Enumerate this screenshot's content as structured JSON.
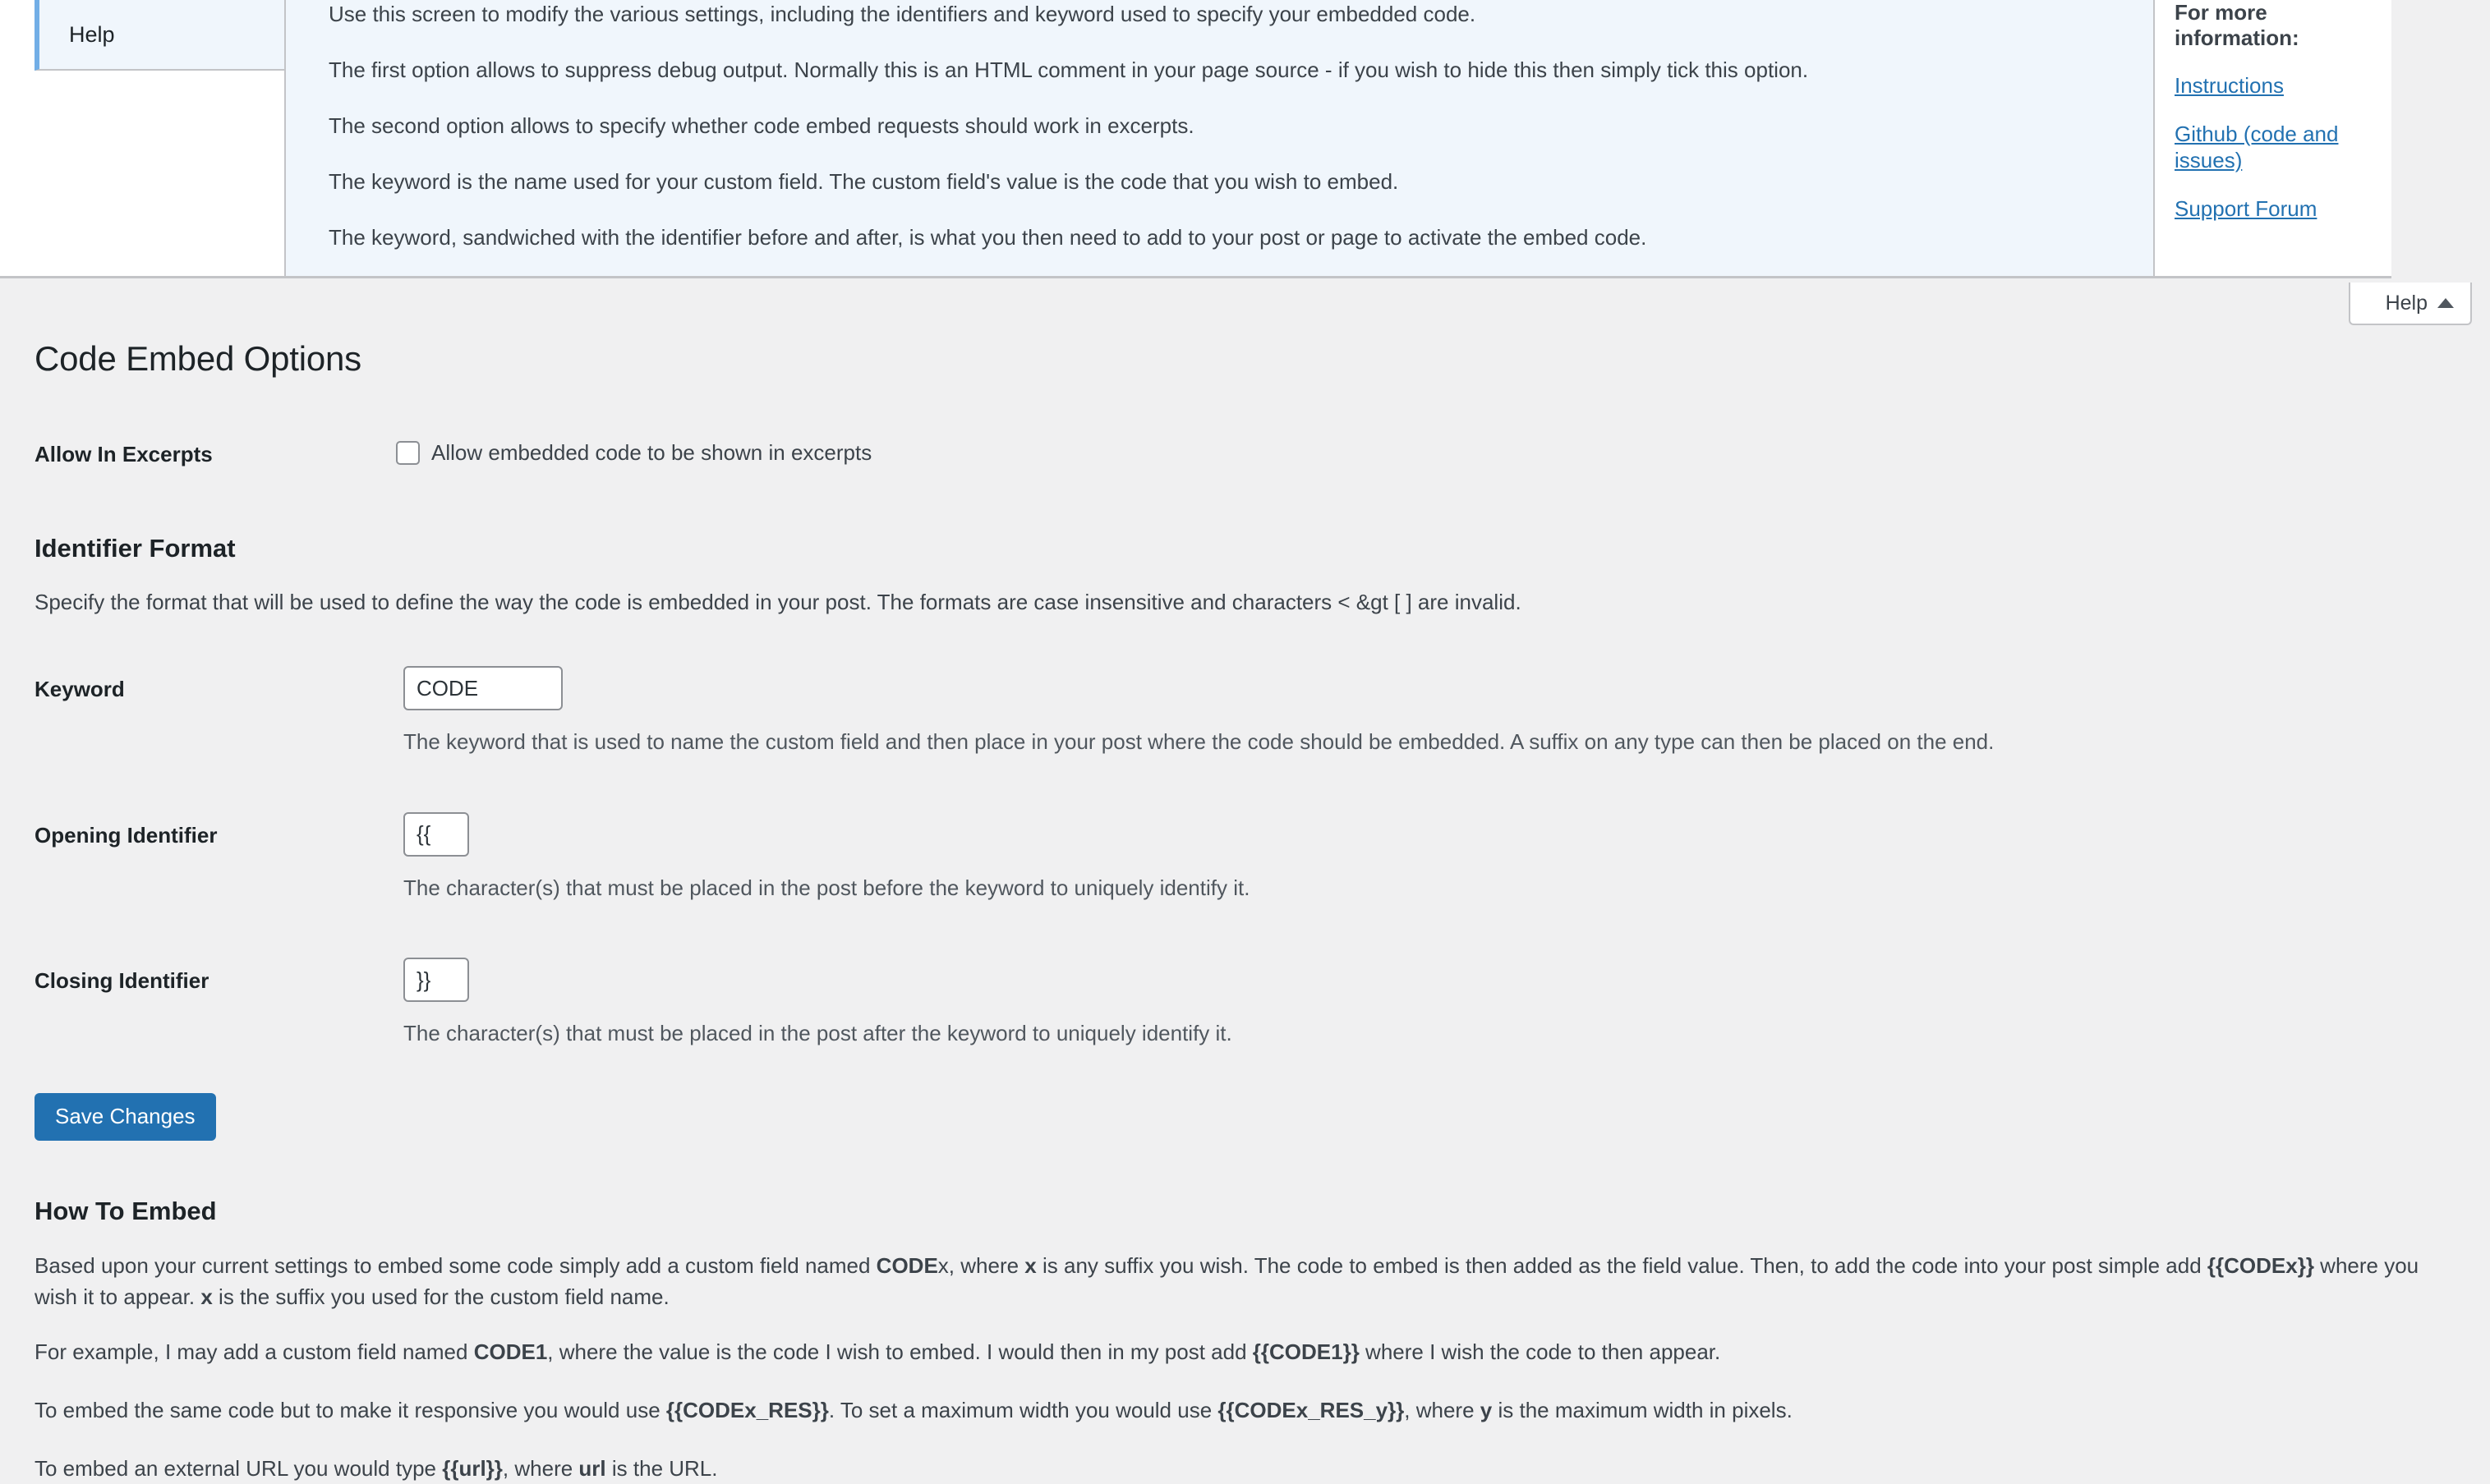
{
  "help_panel": {
    "tabs": [
      {
        "label": "Help",
        "active": true
      }
    ],
    "paragraphs": [
      "Use this screen to modify the various settings, including the identifiers and keyword used to specify your embedded code.",
      "The first option allows to suppress debug output. Normally this is an HTML comment in your page source - if you wish to hide this then simply tick this option.",
      "The second option allows to specify whether code embed requests should work in excerpts.",
      "The keyword is the name used for your custom field. The custom field's value is the code that you wish to embed.",
      "The keyword, sandwiched with the identifier before and after, is what you then need to add to your post or page to activate the embed code."
    ],
    "sidebar": {
      "title": "For more information:",
      "links": [
        "Instructions",
        "Github (code and issues)",
        "Support Forum"
      ]
    },
    "toggle_label": "Help"
  },
  "page": {
    "title": "Code Embed Options"
  },
  "options": {
    "allow_in_excerpts": {
      "label": "Allow In Excerpts",
      "checkbox_label": "Allow embedded code to be shown in excerpts",
      "checked": false
    }
  },
  "identifier_format": {
    "heading": "Identifier Format",
    "description": "Specify the format that will be used to define the way the code is embedded in your post. The formats are case insensitive and characters < &gt [ ] are invalid.",
    "fields": [
      {
        "label": "Keyword",
        "value": "CODE",
        "description": "The keyword that is used to name the custom field and then place in your post where the code should be embedded. A suffix on any type can then be placed on the end."
      },
      {
        "label": "Opening Identifier",
        "value": "{{",
        "description": "The character(s) that must be placed in the post before the keyword to uniquely identify it."
      },
      {
        "label": "Closing Identifier",
        "value": "}}",
        "description": "The character(s) that must be placed in the post after the keyword to uniquely identify it."
      }
    ]
  },
  "actions": {
    "save_label": "Save Changes"
  },
  "how_to_embed": {
    "heading": "How To Embed",
    "p1": {
      "a": "Based upon your current settings to embed some code simply add a custom field named ",
      "b1": "CODE",
      "c": "x, where ",
      "b2": "x",
      "d": " is any suffix you wish. The code to embed is then added as the field value. Then, to add the code into your post simple add ",
      "b3": "{{CODEx}}",
      "e": " where you wish it to appear. ",
      "b4": "x",
      "f": " is the suffix you used for the custom field name."
    },
    "p2": {
      "a": "For example, I may add a custom field named ",
      "b1": "CODE1",
      "c": ", where the value is the code I wish to embed. I would then in my post add ",
      "b2": "{{CODE1}}",
      "d": " where I wish the code to then appear."
    },
    "p3": {
      "a": "To embed the same code but to make it responsive you would use ",
      "b1": "{{CODEx_RES}}",
      "c": ". To set a maximum width you would use ",
      "b2": "{{CODEx_RES_y}}",
      "d": ", where ",
      "b3": "y",
      "e": " is the maximum width in pixels."
    },
    "p4": {
      "a": "To embed an external URL you would type ",
      "b1": "{{url}}",
      "c": ", where ",
      "b2": "url",
      "d": " is the URL."
    }
  },
  "colors": {
    "accent": "#2271b1",
    "help_bg": "#f0f6fc",
    "page_bg": "#f0f0f1"
  }
}
